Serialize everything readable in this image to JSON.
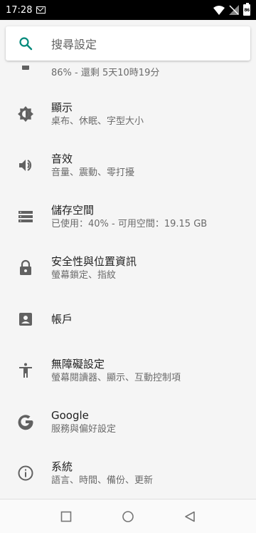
{
  "status_bar": {
    "time": "17:28",
    "battery_label": "86"
  },
  "search": {
    "placeholder": "搜尋設定"
  },
  "partial_item": {
    "subtitle": "86% - 還剩 5天10時19分"
  },
  "settings": [
    {
      "title": "顯示",
      "subtitle": "桌布、休眠、字型大小",
      "icon": "brightness-icon"
    },
    {
      "title": "音效",
      "subtitle": "音量、震動、零打擾",
      "icon": "volume-icon"
    },
    {
      "title": "儲存空間",
      "subtitle": "已使用：40% - 可用空間：19.15 GB",
      "icon": "storage-icon"
    },
    {
      "title": "安全性與位置資訊",
      "subtitle": "螢幕鎖定、指紋",
      "icon": "lock-icon"
    },
    {
      "title": "帳戶",
      "subtitle": "",
      "icon": "account-icon"
    },
    {
      "title": "無障礙設定",
      "subtitle": "螢幕閱讀器、顯示、互動控制項",
      "icon": "accessibility-icon"
    },
    {
      "title": "Google",
      "subtitle": "服務與偏好設定",
      "icon": "google-icon"
    },
    {
      "title": "系統",
      "subtitle": "語言、時間、備份、更新",
      "icon": "info-icon"
    }
  ],
  "colors": {
    "accent": "#00897b",
    "icon": "#616161",
    "background": "#f5f5f5"
  }
}
